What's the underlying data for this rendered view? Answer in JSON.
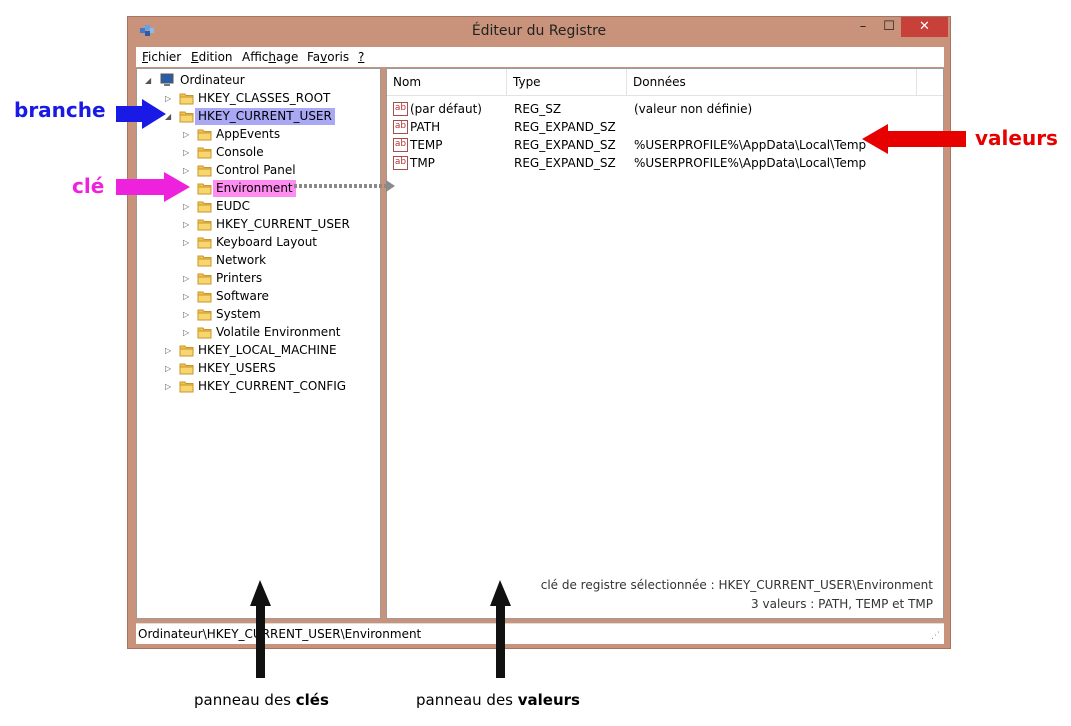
{
  "window": {
    "title": "Éditeur du Registre",
    "buttons": {
      "minimize": "–",
      "maximize": "☐",
      "close": "✕"
    }
  },
  "menu": [
    {
      "prefix": "",
      "underlined": "F",
      "rest": "ichier"
    },
    {
      "prefix": "",
      "underlined": "E",
      "rest": "dition"
    },
    {
      "prefix": "Affic",
      "underlined": "h",
      "rest": "age"
    },
    {
      "prefix": "Fa",
      "underlined": "v",
      "rest": "oris"
    },
    {
      "prefix": "",
      "underlined": "?",
      "rest": ""
    }
  ],
  "tree": {
    "root": "Ordinateur",
    "branches": {
      "classes_root": "HKEY_CLASSES_ROOT",
      "current_user": "HKEY_CURRENT_USER",
      "local_machine": "HKEY_LOCAL_MACHINE",
      "users": "HKEY_USERS",
      "current_config": "HKEY_CURRENT_CONFIG"
    },
    "subkeys": [
      "AppEvents",
      "Console",
      "Control Panel",
      "Environment",
      "EUDC",
      "HKEY_CURRENT_USER",
      "Keyboard Layout",
      "Network",
      "Printers",
      "Software",
      "System",
      "Volatile Environment"
    ]
  },
  "values": {
    "columns": [
      "Nom",
      "Type",
      "Données"
    ],
    "rows": [
      {
        "name": "(par défaut)",
        "type": "REG_SZ",
        "data": "(valeur non définie)"
      },
      {
        "name": "PATH",
        "type": "REG_EXPAND_SZ",
        "data": ""
      },
      {
        "name": "TEMP",
        "type": "REG_EXPAND_SZ",
        "data": "%USERPROFILE%\\AppData\\Local\\Temp"
      },
      {
        "name": "TMP",
        "type": "REG_EXPAND_SZ",
        "data": "%USERPROFILE%\\AppData\\Local\\Temp"
      }
    ],
    "icon_label": "ab",
    "note_line1": "clé de registre sélectionnée : HKEY_CURRENT_USER\\Environment",
    "note_line2": "3 valeurs : PATH, TEMP et TMP"
  },
  "status": "Ordinateur\\HKEY_CURRENT_USER\\Environment",
  "annotations": {
    "branche": "branche",
    "cle": "clé",
    "valeurs": "valeurs",
    "panel_keys_prefix": "panneau des ",
    "panel_keys_bold": "clés",
    "panel_values_prefix": "panneau des ",
    "panel_values_bold": "valeurs"
  },
  "colors": {
    "branche": "#1a1ae6",
    "cle": "#ee22dd",
    "valeurs": "#e60000",
    "window_frame": "#c8937a"
  }
}
